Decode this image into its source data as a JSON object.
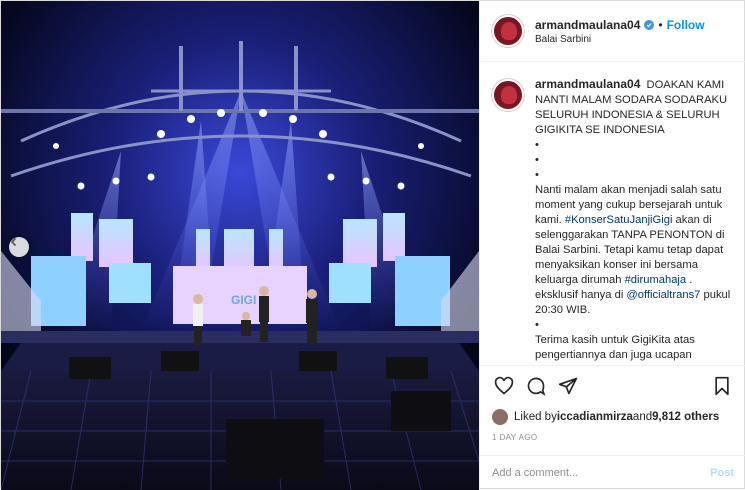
{
  "header": {
    "username": "armandmaulana04",
    "follow_label": "Follow",
    "separator": "•",
    "location": "Balai Sarbini",
    "verified_icon": "verified-badge-icon"
  },
  "caption": {
    "username": "armandmaulana04",
    "lines": [
      "DOAKAN KAMI NANTI MALAM SODARA SODARAKU SELURUH INDONESIA & SELURUH GIGIKITA SE INDONESIA",
      "•",
      "•",
      "•"
    ],
    "para2_a": "Nanti malam akan menjadi salah satu moment yang cukup bersejarah untuk kami. ",
    "hashtag1": "#KonserSatuJanjiGigi",
    "para2_b": " akan di selenggarakan TANPA PENONTON di Balai Sarbini. Tetapi kamu tetap dapat menyaksikan konser ini bersama keluarga dirumah ",
    "hashtag2": "#dirumahaja",
    "para2_c": " . eksklusif hanya di ",
    "mention": "@officialtrans7",
    "para2_d": " pukul 20:30 WIB.",
    "bullet": "•",
    "para3": "Terima kasih untuk GigiKita atas pengertiannya dan juga ucapan"
  },
  "actions": {
    "like_icon": "heart-icon",
    "comment_icon": "comment-icon",
    "share_icon": "share-icon",
    "save_icon": "bookmark-icon"
  },
  "likes": {
    "prefix": "Liked by ",
    "user": "iccadianmirza",
    "middle": " and ",
    "count": "9,812 others"
  },
  "timestamp": "1 DAY AGO",
  "comment_box": {
    "placeholder": "Add a comment...",
    "post_label": "Post"
  },
  "media": {
    "alt": "Concert stage photo",
    "stage_screen_text": "GIGI"
  }
}
